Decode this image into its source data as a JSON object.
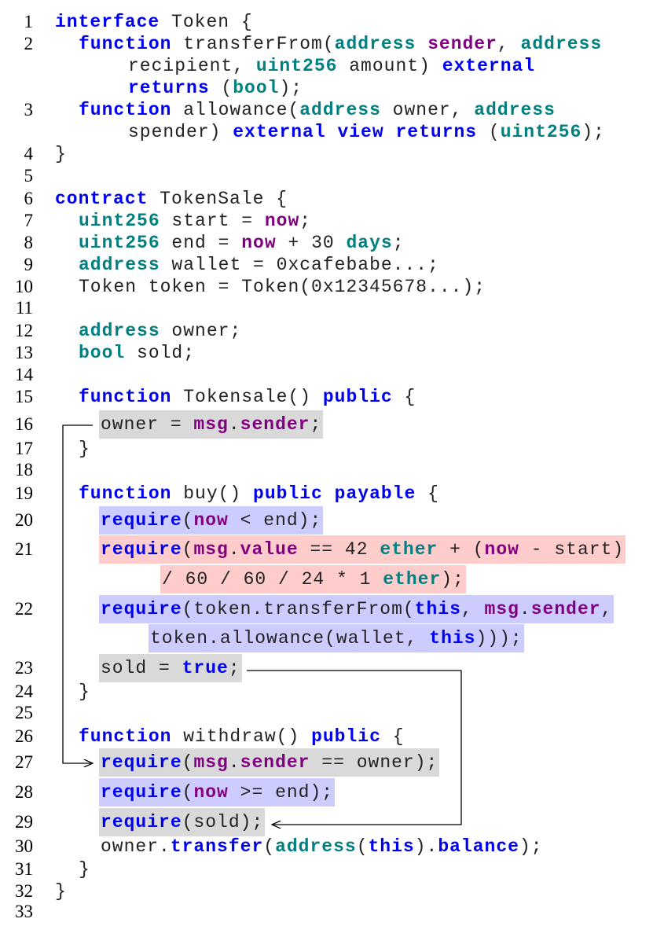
{
  "colors": {
    "keyword": "#0000f0",
    "type": "#008080",
    "builtin": "#800080",
    "highlight_gray": "#d9d9d9",
    "highlight_blue": "#ccccff",
    "highlight_pink": "#ffcccc"
  },
  "rows": [
    {
      "n": "1",
      "hl": "",
      "segs": [
        {
          "t": "interface",
          "c": "k"
        },
        {
          "t": " Token {",
          "c": ""
        }
      ]
    },
    {
      "n": "2",
      "hl": "",
      "segs": [
        {
          "t": "function",
          "c": "k"
        },
        {
          "t": " transferFrom(",
          "c": ""
        },
        {
          "t": "address",
          "c": "t"
        },
        {
          "t": " ",
          "c": ""
        },
        {
          "t": "sender",
          "c": "p"
        },
        {
          "t": ", ",
          "c": ""
        },
        {
          "t": "address",
          "c": "t"
        }
      ]
    },
    {
      "n": "",
      "hl": "",
      "segs": [
        {
          "t": "recipient, ",
          "c": ""
        },
        {
          "t": "uint256",
          "c": "t"
        },
        {
          "t": " amount) ",
          "c": ""
        },
        {
          "t": "external",
          "c": "k"
        }
      ]
    },
    {
      "n": "",
      "hl": "",
      "segs": [
        {
          "t": "returns",
          "c": "k"
        },
        {
          "t": " (",
          "c": ""
        },
        {
          "t": "bool",
          "c": "t"
        },
        {
          "t": ");",
          "c": ""
        }
      ]
    },
    {
      "n": "3",
      "hl": "",
      "segs": [
        {
          "t": "function",
          "c": "k"
        },
        {
          "t": " allowance(",
          "c": ""
        },
        {
          "t": "address",
          "c": "t"
        },
        {
          "t": " owner, ",
          "c": ""
        },
        {
          "t": "address",
          "c": "t"
        }
      ]
    },
    {
      "n": "",
      "hl": "",
      "segs": [
        {
          "t": "spender) ",
          "c": ""
        },
        {
          "t": "external view returns",
          "c": "k"
        },
        {
          "t": " (",
          "c": ""
        },
        {
          "t": "uint256",
          "c": "t"
        },
        {
          "t": ");",
          "c": ""
        }
      ]
    },
    {
      "n": "4",
      "hl": "",
      "segs": [
        {
          "t": "}",
          "c": ""
        }
      ]
    },
    {
      "n": "5",
      "hl": "",
      "segs": []
    },
    {
      "n": "6",
      "hl": "",
      "segs": [
        {
          "t": "contract",
          "c": "k"
        },
        {
          "t": " TokenSale {",
          "c": ""
        }
      ]
    },
    {
      "n": "7",
      "hl": "",
      "segs": [
        {
          "t": "uint256",
          "c": "t"
        },
        {
          "t": " start = ",
          "c": ""
        },
        {
          "t": "now",
          "c": "p"
        },
        {
          "t": ";",
          "c": ""
        }
      ]
    },
    {
      "n": "8",
      "hl": "",
      "segs": [
        {
          "t": "uint256",
          "c": "t"
        },
        {
          "t": " end = ",
          "c": ""
        },
        {
          "t": "now",
          "c": "p"
        },
        {
          "t": " + 30 ",
          "c": ""
        },
        {
          "t": "days",
          "c": "t"
        },
        {
          "t": ";",
          "c": ""
        }
      ]
    },
    {
      "n": "9",
      "hl": "",
      "segs": [
        {
          "t": "address",
          "c": "t"
        },
        {
          "t": " wallet = 0xcafebabe...;",
          "c": ""
        }
      ]
    },
    {
      "n": "10",
      "hl": "",
      "segs": [
        {
          "t": "Token token = Token(0x12345678...);",
          "c": ""
        }
      ]
    },
    {
      "n": "11",
      "hl": "",
      "segs": []
    },
    {
      "n": "12",
      "hl": "",
      "segs": [
        {
          "t": "address",
          "c": "t"
        },
        {
          "t": " owner;",
          "c": ""
        }
      ]
    },
    {
      "n": "13",
      "hl": "",
      "segs": [
        {
          "t": "bool",
          "c": "t"
        },
        {
          "t": " sold;",
          "c": ""
        }
      ]
    },
    {
      "n": "14",
      "hl": "",
      "segs": []
    },
    {
      "n": "15",
      "hl": "",
      "segs": [
        {
          "t": "function",
          "c": "k"
        },
        {
          "t": " Tokensale() ",
          "c": ""
        },
        {
          "t": "public",
          "c": "k"
        },
        {
          "t": " {",
          "c": ""
        }
      ]
    },
    {
      "n": "16",
      "hl": "gray",
      "segs": [
        {
          "t": "owner = ",
          "c": ""
        },
        {
          "t": "msg",
          "c": "p"
        },
        {
          "t": ".",
          "c": ""
        },
        {
          "t": "sender",
          "c": "p"
        },
        {
          "t": ";",
          "c": ""
        }
      ]
    },
    {
      "n": "17",
      "hl": "",
      "segs": [
        {
          "t": "}",
          "c": ""
        }
      ]
    },
    {
      "n": "18",
      "hl": "",
      "segs": []
    },
    {
      "n": "19",
      "hl": "",
      "segs": [
        {
          "t": "function",
          "c": "k"
        },
        {
          "t": " buy() ",
          "c": ""
        },
        {
          "t": "public payable",
          "c": "k"
        },
        {
          "t": " {",
          "c": ""
        }
      ]
    },
    {
      "n": "20",
      "hl": "blue",
      "segs": [
        {
          "t": "require",
          "c": "k"
        },
        {
          "t": "(",
          "c": ""
        },
        {
          "t": "now",
          "c": "p"
        },
        {
          "t": " < end);",
          "c": ""
        }
      ]
    },
    {
      "n": "21",
      "hl": "pink",
      "segs": [
        {
          "t": "require",
          "c": "k"
        },
        {
          "t": "(",
          "c": ""
        },
        {
          "t": "msg",
          "c": "p"
        },
        {
          "t": ".",
          "c": ""
        },
        {
          "t": "value",
          "c": "p"
        },
        {
          "t": " == 42 ",
          "c": ""
        },
        {
          "t": "ether",
          "c": "t"
        },
        {
          "t": " + (",
          "c": ""
        },
        {
          "t": "now",
          "c": "p"
        },
        {
          "t": " - start)",
          "c": ""
        }
      ]
    },
    {
      "n": "",
      "hl": "pink",
      "segs": [
        {
          "t": "/ 60 / 60 / 24 * 1 ",
          "c": ""
        },
        {
          "t": "ether",
          "c": "t"
        },
        {
          "t": ");",
          "c": ""
        }
      ]
    },
    {
      "n": "22",
      "hl": "blue",
      "segs": [
        {
          "t": "require",
          "c": "k"
        },
        {
          "t": "(token.transferFrom(",
          "c": ""
        },
        {
          "t": "this",
          "c": "k"
        },
        {
          "t": ", ",
          "c": ""
        },
        {
          "t": "msg",
          "c": "p"
        },
        {
          "t": ".",
          "c": ""
        },
        {
          "t": "sender",
          "c": "p"
        },
        {
          "t": ",",
          "c": ""
        }
      ]
    },
    {
      "n": "",
      "hl": "blue",
      "segs": [
        {
          "t": "token.allowance(wallet, ",
          "c": ""
        },
        {
          "t": "this",
          "c": "k"
        },
        {
          "t": ")));",
          "c": ""
        }
      ]
    },
    {
      "n": "23",
      "hl": "gray",
      "segs": [
        {
          "t": "sold = ",
          "c": ""
        },
        {
          "t": "true",
          "c": "k"
        },
        {
          "t": ";",
          "c": ""
        }
      ]
    },
    {
      "n": "24",
      "hl": "",
      "segs": [
        {
          "t": "}",
          "c": ""
        }
      ]
    },
    {
      "n": "25",
      "hl": "",
      "segs": []
    },
    {
      "n": "26",
      "hl": "",
      "segs": [
        {
          "t": "function",
          "c": "k"
        },
        {
          "t": " withdraw() ",
          "c": ""
        },
        {
          "t": "public",
          "c": "k"
        },
        {
          "t": " {",
          "c": ""
        }
      ]
    },
    {
      "n": "27",
      "hl": "gray",
      "segs": [
        {
          "t": "require",
          "c": "k"
        },
        {
          "t": "(",
          "c": ""
        },
        {
          "t": "msg",
          "c": "p"
        },
        {
          "t": ".",
          "c": ""
        },
        {
          "t": "sender",
          "c": "p"
        },
        {
          "t": " == owner);",
          "c": ""
        }
      ]
    },
    {
      "n": "28",
      "hl": "blue",
      "segs": [
        {
          "t": "require",
          "c": "k"
        },
        {
          "t": "(",
          "c": ""
        },
        {
          "t": "now",
          "c": "p"
        },
        {
          "t": " >= end);",
          "c": ""
        }
      ]
    },
    {
      "n": "29",
      "hl": "gray",
      "segs": [
        {
          "t": "require",
          "c": "k"
        },
        {
          "t": "(sold);",
          "c": ""
        }
      ]
    },
    {
      "n": "30",
      "hl": "",
      "segs": [
        {
          "t": "owner.",
          "c": ""
        },
        {
          "t": "transfer",
          "c": "k"
        },
        {
          "t": "(",
          "c": ""
        },
        {
          "t": "address",
          "c": "t"
        },
        {
          "t": "(",
          "c": ""
        },
        {
          "t": "this",
          "c": "k"
        },
        {
          "t": ").",
          "c": ""
        },
        {
          "t": "balance",
          "c": "k"
        },
        {
          "t": ");",
          "c": ""
        }
      ]
    },
    {
      "n": "31",
      "hl": "",
      "segs": [
        {
          "t": "}",
          "c": ""
        }
      ]
    },
    {
      "n": "32",
      "hl": "",
      "segs": [
        {
          "t": "}",
          "c": ""
        }
      ]
    },
    {
      "n": "33",
      "hl": "",
      "segs": []
    }
  ]
}
